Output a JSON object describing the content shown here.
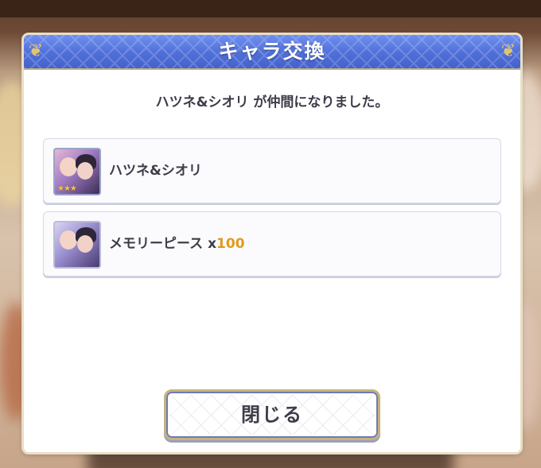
{
  "dialog": {
    "title": "キャラ交換",
    "message": "ハツネ&シオリ が仲間になりました。",
    "rewards": [
      {
        "name": "ハツネ&シオリ",
        "icon": "character-portrait-icon",
        "stars": "★★★"
      },
      {
        "name": "メモリーピース x",
        "quantity": "100",
        "icon": "memory-piece-icon"
      }
    ],
    "close_label": "閉じる"
  },
  "colors": {
    "header": "#4f6fd8",
    "quantity": "#e09a1c",
    "button_border": "#c8b27c"
  }
}
